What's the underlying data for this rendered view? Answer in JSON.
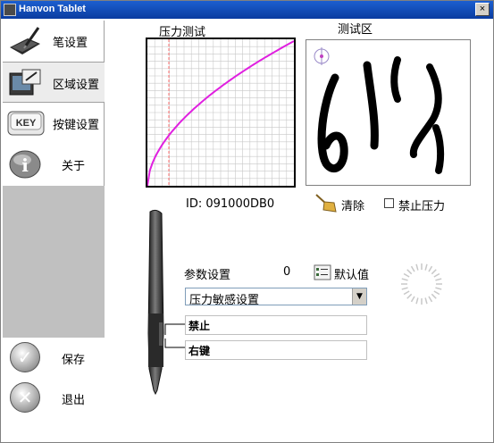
{
  "window": {
    "title": "Hanvon Tablet",
    "close_glyph": "×"
  },
  "sidebar": {
    "items": [
      {
        "label": "笔设置",
        "icon": "pen-tablet-icon"
      },
      {
        "label": "区域设置",
        "icon": "area-setting-icon"
      },
      {
        "label": "按键设置",
        "icon": "key-icon"
      },
      {
        "label": "关于",
        "icon": "info-icon"
      }
    ],
    "key_icon_text": "KEY",
    "info_icon_text": "i",
    "active_index": 1
  },
  "actions": {
    "save_label": "保存",
    "exit_label": "退出"
  },
  "pressure_panel": {
    "title": "压力测试"
  },
  "test_panel": {
    "title": "测试区"
  },
  "device": {
    "id_text": "ID: 091000DB0"
  },
  "toolbar": {
    "clear_label": "清除",
    "disable_pressure_label": "禁止压力"
  },
  "params": {
    "label": "参数设置",
    "value": "0",
    "default_label": "默认值",
    "select_value": "压力敏感设置",
    "button_field_1": "禁止",
    "button_field_2": "右键"
  },
  "colors": {
    "curve": "#e020e0",
    "grid": "#c8c8c8",
    "guide": "#ff7070"
  }
}
